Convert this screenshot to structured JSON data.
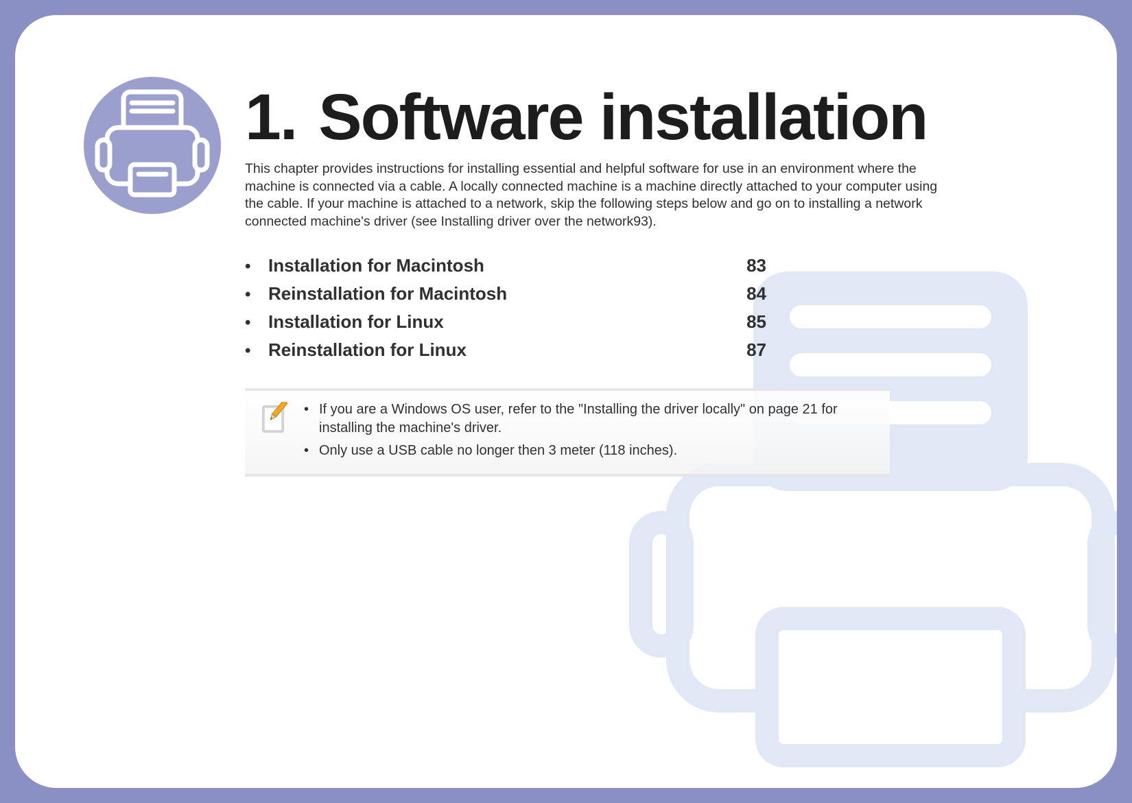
{
  "chapter": {
    "number": "1.",
    "title": "Software installation"
  },
  "intro": "This chapter provides instructions for installing essential and helpful software for use in an environment where the machine is connected via a cable. A locally connected machine is a machine directly attached to your computer using the cable. If your machine is attached to a network, skip the following steps below and go on to installing a network connected machine's driver (see Installing driver over the network93).",
  "toc": [
    {
      "label": "Installation for Macintosh",
      "page": "83"
    },
    {
      "label": "Reinstallation for Macintosh",
      "page": "84"
    },
    {
      "label": "Installation for Linux",
      "page": "85"
    },
    {
      "label": "Reinstallation for Linux",
      "page": "87"
    }
  ],
  "notes": [
    "If you are a Windows OS user, refer to the \"Installing the driver locally\" on page 21 for installing the machine's driver.",
    "Only use a USB cable no longer then 3 meter (118 inches)."
  ],
  "colors": {
    "frame": "#8a8fc4",
    "badge": "#9a9fce",
    "watermark": "#e0e8f5"
  }
}
